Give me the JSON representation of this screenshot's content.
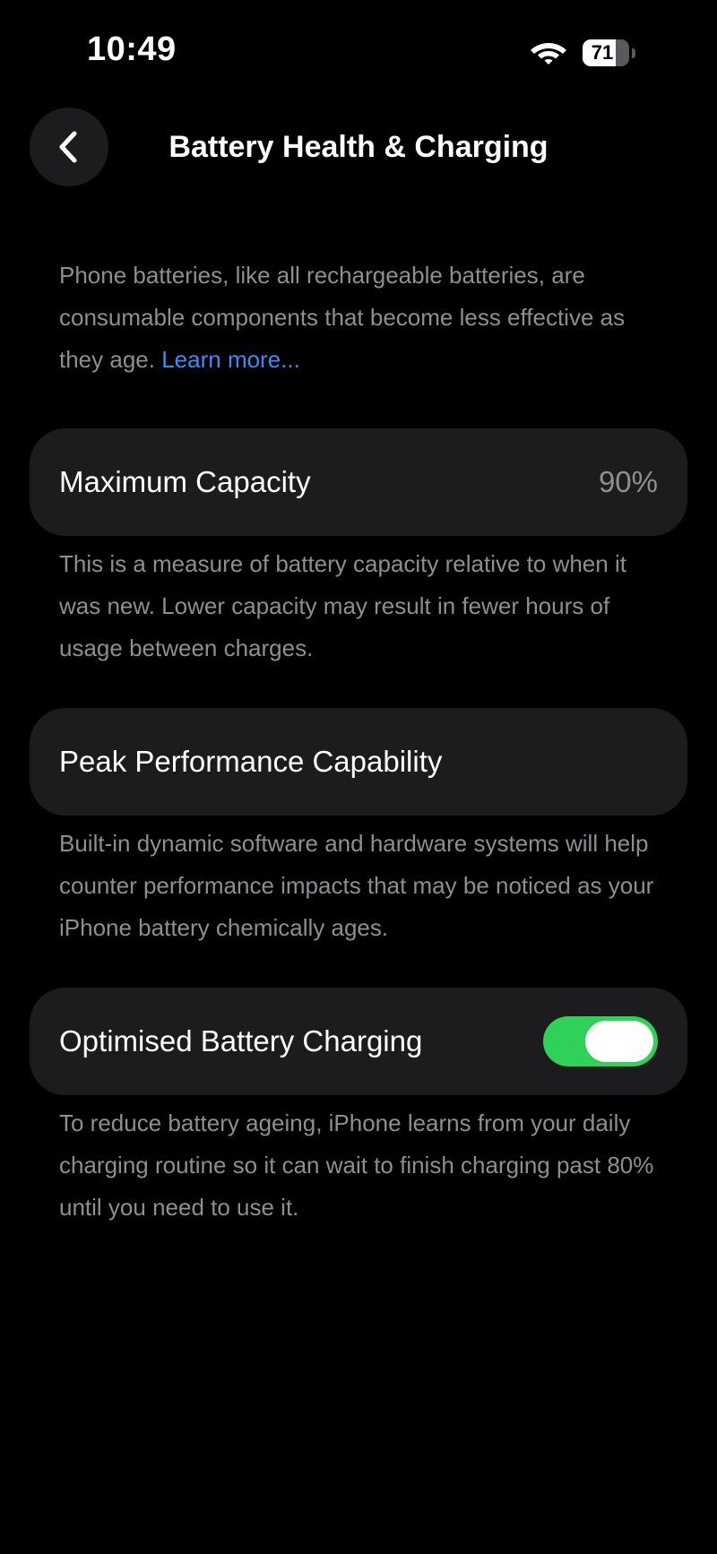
{
  "status_bar": {
    "time": "10:49",
    "battery_level": "71",
    "battery_fraction": 0.71
  },
  "nav": {
    "title": "Battery Health & Charging",
    "back_icon": "chevron-left-icon"
  },
  "intro": {
    "text": "Phone batteries, like all rechargeable batteries, are consumable components that become less effective as they age.",
    "link": "Learn more..."
  },
  "max_capacity": {
    "label": "Maximum Capacity",
    "value": "90%",
    "description": "This is a measure of battery capacity relative to when it was new. Lower capacity may result in fewer hours of usage between charges."
  },
  "peak_performance": {
    "label": "Peak Performance Capability",
    "description": "Built-in dynamic software and hardware systems will help counter performance impacts that may be noticed as your iPhone battery chemically ages."
  },
  "optimised_charging": {
    "label": "Optimised Battery Charging",
    "enabled": true,
    "description": "To reduce battery ageing, iPhone learns from your daily charging routine so it can wait to finish charging past 80% until you need to use it."
  },
  "colors": {
    "background": "#000000",
    "card": "#1c1c1e",
    "secondary_text": "#8e8e93",
    "link": "#3b8cf5",
    "toggle_on": "#30d158"
  }
}
